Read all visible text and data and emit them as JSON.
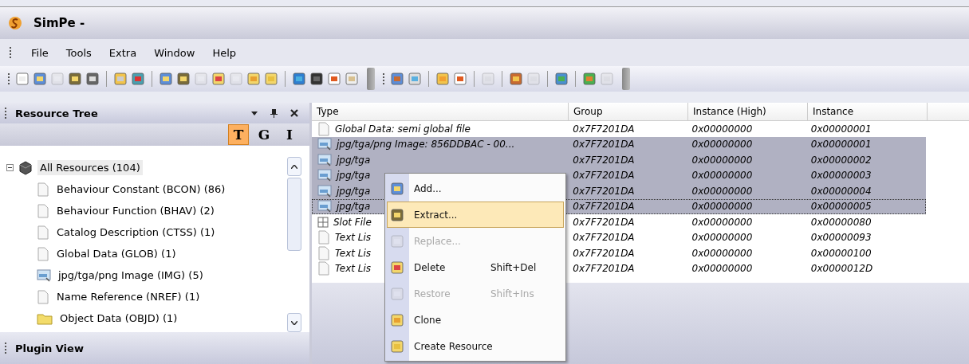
{
  "window": {
    "title": "SimPe -"
  },
  "menu": [
    {
      "label": "File"
    },
    {
      "label": "Tools"
    },
    {
      "label": "Extra"
    },
    {
      "label": "Window"
    },
    {
      "label": "Help"
    }
  ],
  "resource_tree": {
    "title": "Resource Tree",
    "view_buttons": [
      {
        "label": "T",
        "selected": true
      },
      {
        "label": "G",
        "selected": false
      },
      {
        "label": "I",
        "selected": false
      }
    ],
    "tree": [
      {
        "label": "All Resources (104)",
        "expanded": true,
        "selected": true,
        "kind": "package",
        "children": [
          {
            "label": "Behaviour Constant (BCON) (86)",
            "kind": "doc",
            "selected": false
          },
          {
            "label": "Behaviour Function (BHAV) (2)",
            "kind": "doc",
            "selected": false
          },
          {
            "label": "Catalog Description (CTSS) (1)",
            "kind": "doc",
            "selected": false
          },
          {
            "label": "Global Data (GLOB) (1)",
            "kind": "doc",
            "selected": false
          },
          {
            "label": "jpg/tga/png Image (IMG) (5)",
            "kind": "image",
            "selected": false
          },
          {
            "label": "Name Reference (NREF) (1)",
            "kind": "doc",
            "selected": false
          },
          {
            "label": "Object Data (OBJD) (1)",
            "kind": "folder",
            "selected": false
          }
        ]
      }
    ]
  },
  "plugin_view": {
    "title": "Plugin View"
  },
  "table": {
    "columns": [
      "Type",
      "Group",
      "Instance (High)",
      "Instance"
    ],
    "rows": [
      {
        "kind": "doc",
        "type": "Global Data: semi global file",
        "group": "0x7F7201DA",
        "instance_high": "0x00000000",
        "instance": "0x00000001",
        "selected": false,
        "focused": false
      },
      {
        "kind": "image",
        "type": "jpg/tga/png Image: 856DDBAC - 00...",
        "group": "0x7F7201DA",
        "instance_high": "0x00000000",
        "instance": "0x00000001",
        "selected": true,
        "focused": false
      },
      {
        "kind": "image",
        "type": "jpg/tga",
        "group": "0x7F7201DA",
        "instance_high": "0x00000000",
        "instance": "0x00000002",
        "selected": true,
        "focused": false
      },
      {
        "kind": "image",
        "type": "jpg/tga",
        "group": "0x7F7201DA",
        "instance_high": "0x00000000",
        "instance": "0x00000003",
        "selected": true,
        "focused": false
      },
      {
        "kind": "image",
        "type": "jpg/tga",
        "group": "0x7F7201DA",
        "instance_high": "0x00000000",
        "instance": "0x00000004",
        "selected": true,
        "focused": false
      },
      {
        "kind": "image",
        "type": "jpg/tga",
        "group": "0x7F7201DA",
        "instance_high": "0x00000000",
        "instance": "0x00000005",
        "selected": true,
        "focused": true
      },
      {
        "kind": "slot",
        "type": "Slot File",
        "group": "0x7F7201DA",
        "instance_high": "0x00000000",
        "instance": "0x00000080",
        "selected": false,
        "focused": false
      },
      {
        "kind": "doc",
        "type": "Text Lis",
        "group": "0x7F7201DA",
        "instance_high": "0x00000000",
        "instance": "0x00000093",
        "selected": false,
        "focused": false
      },
      {
        "kind": "doc",
        "type": "Text Lis",
        "group": "0x7F7201DA",
        "instance_high": "0x00000000",
        "instance": "0x00000100",
        "selected": false,
        "focused": false
      },
      {
        "kind": "doc",
        "type": "Text Lis",
        "group": "0x7F7201DA",
        "instance_high": "0x00000000",
        "instance": "0x0000012D",
        "selected": false,
        "focused": false
      }
    ]
  },
  "context_menu": {
    "items": [
      {
        "label": "Add...",
        "disabled": false,
        "selected": false
      },
      {
        "label": "Extract...",
        "disabled": false,
        "selected": true
      },
      {
        "label": "Replace...",
        "disabled": true,
        "selected": false
      },
      {
        "label": "Delete",
        "shortcut": "Shift+Del",
        "disabled": false,
        "selected": false
      },
      {
        "label": "Restore",
        "shortcut": "Shift+Ins",
        "disabled": true,
        "selected": false
      },
      {
        "label": "Clone",
        "disabled": false,
        "selected": false
      },
      {
        "label": "Create Resource",
        "disabled": false,
        "selected": false
      }
    ]
  }
}
